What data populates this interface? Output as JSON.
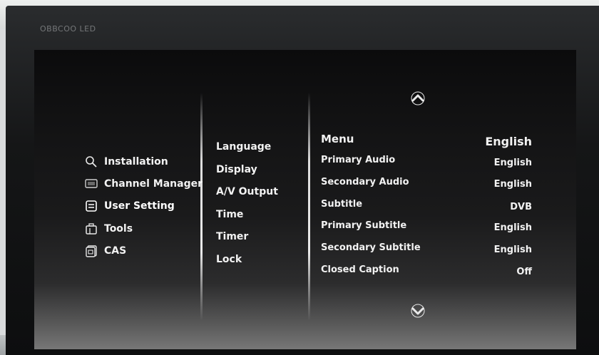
{
  "monitor": {
    "brand": "OBBCOO LED"
  },
  "nav": {
    "items": [
      {
        "label": "Installation",
        "icon": "search-icon"
      },
      {
        "label": "Channel Manager",
        "icon": "tv-icon"
      },
      {
        "label": "User Setting",
        "icon": "settings-box-icon",
        "active": true
      },
      {
        "label": "Tools",
        "icon": "toolbox-icon"
      },
      {
        "label": "CAS",
        "icon": "card-icon"
      }
    ]
  },
  "submenu": {
    "items": [
      "Language",
      "Display",
      "A/V Output",
      "Time",
      "Timer",
      "Lock"
    ],
    "selected": "Language"
  },
  "settings": {
    "header": {
      "label": "Menu",
      "value": "English"
    },
    "rows": [
      {
        "label": "Primary Audio",
        "value": "English"
      },
      {
        "label": "Secondary Audio",
        "value": "English"
      },
      {
        "label": "Subtitle",
        "value": "DVB"
      },
      {
        "label": "Primary Subtitle",
        "value": "English"
      },
      {
        "label": "Secondary Subtitle",
        "value": "English"
      },
      {
        "label": "Closed Caption",
        "value": "Off"
      }
    ]
  },
  "arrows": {
    "up": "chevron-up-icon",
    "down": "chevron-down-icon"
  },
  "colors": {
    "text": "#f2f2f2",
    "screen_bg": "#141415",
    "bezel": "#151617"
  }
}
